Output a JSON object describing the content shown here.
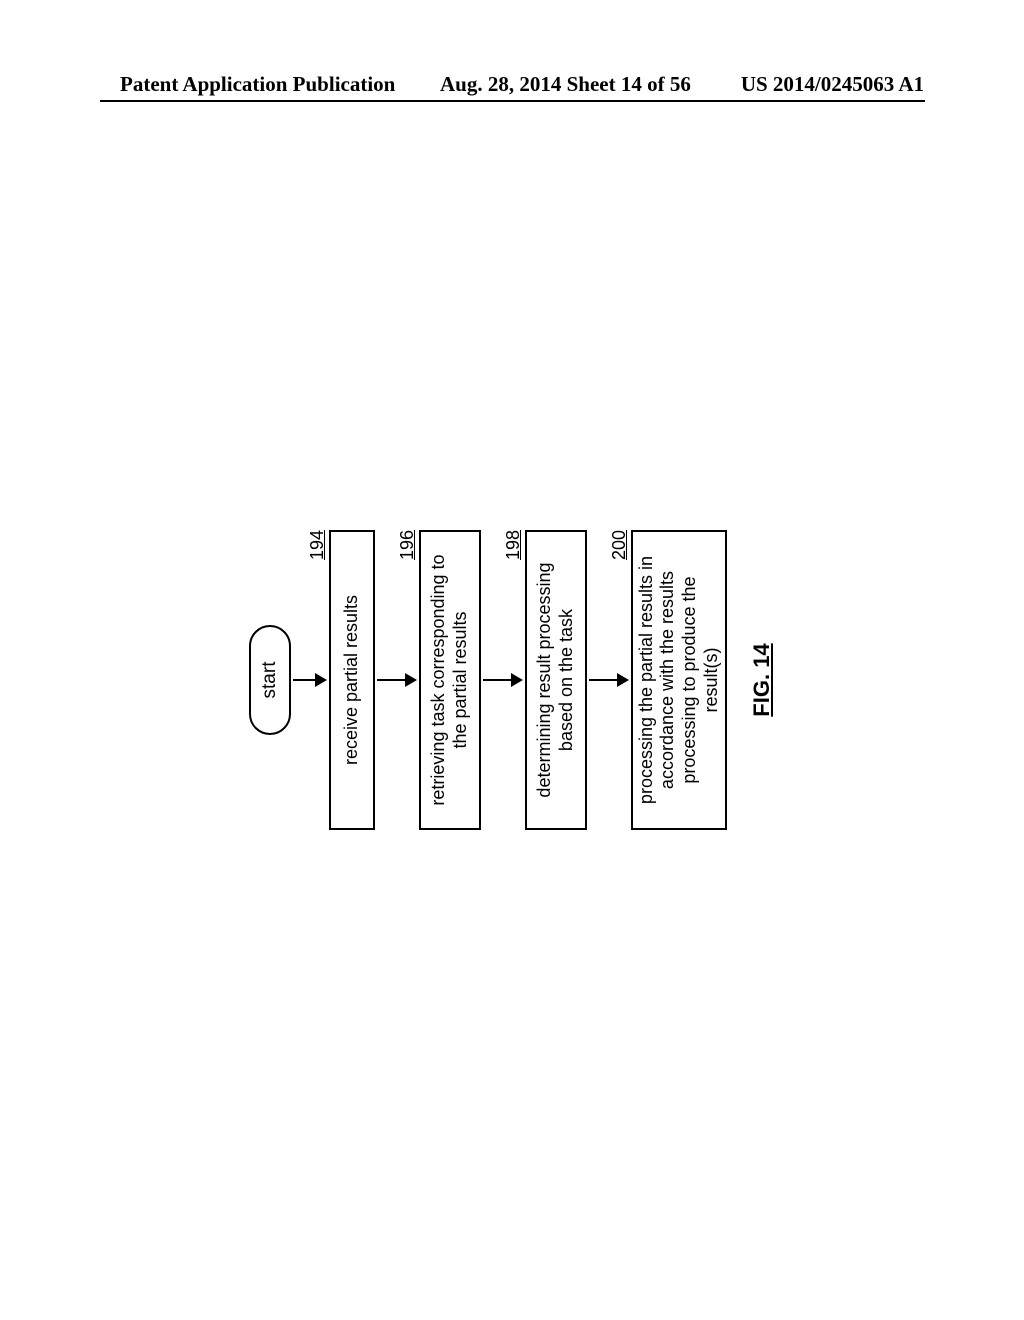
{
  "header": {
    "left": "Patent Application Publication",
    "center": "Aug. 28, 2014  Sheet 14 of 56",
    "right": "US 2014/0245063 A1"
  },
  "flowchart": {
    "start": "start",
    "steps": [
      {
        "num": "194",
        "text": "receive partial results"
      },
      {
        "num": "196",
        "text": "retrieving task corresponding to the partial results"
      },
      {
        "num": "198",
        "text": "determining result processing based on the task"
      },
      {
        "num": "200",
        "text": "processing the partial results in accordance with the results processing to produce the result(s)"
      }
    ],
    "caption": "FIG. 14"
  }
}
